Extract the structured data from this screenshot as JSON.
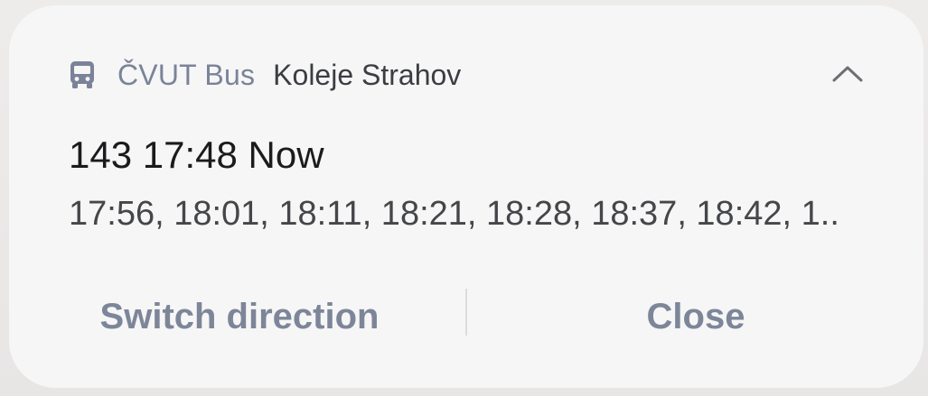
{
  "notification": {
    "app_name": "ČVUT Bus",
    "subtitle": "Koleje Strahov",
    "title": "143 17:48 Now",
    "body": "17:56, 18:01, 18:11, 18:21, 18:28, 18:37, 18:42, 1..",
    "icon": "bus-icon",
    "collapse_icon": "chevron-up-icon"
  },
  "actions": {
    "switch_direction_label": "Switch direction",
    "close_label": "Close"
  },
  "colors": {
    "card_background": "#f6f6f6",
    "app_name": "#7a8398",
    "action_text": "#7d8699",
    "title_text": "#1b1b1d"
  }
}
